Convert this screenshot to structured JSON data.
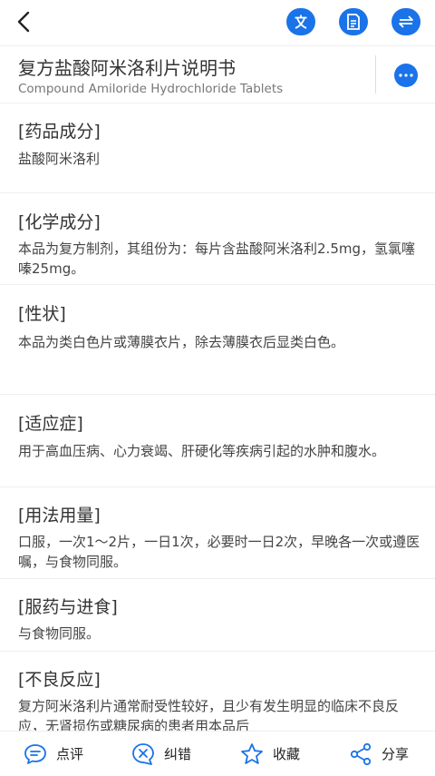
{
  "header": {
    "title_cn": "复方盐酸阿米洛利片说明书",
    "title_en": "Compound Amiloride Hydrochloride Tablets",
    "actions": [
      {
        "icon": "translate-icon"
      },
      {
        "icon": "document-icon"
      },
      {
        "icon": "swap-icon"
      }
    ],
    "accent_color": "#1a73e8"
  },
  "sections": [
    {
      "title": "[药品成分]",
      "body": "盐酸阿米洛利"
    },
    {
      "title": "[化学成分]",
      "body": "本品为复方制剂，其组份为：每片含盐酸阿米洛利2.5mg，氢氯噻嗪25mg。"
    },
    {
      "title": "[性状]",
      "body": "本品为类白色片或薄膜衣片，除去薄膜衣后显类白色。"
    },
    {
      "title": "[适应症]",
      "body": "用于高血压病、心力衰竭、肝硬化等疾病引起的水肿和腹水。"
    },
    {
      "title": "[用法用量]",
      "body": "口服，一次1～2片，一日1次，必要时一日2次，早晚各一次或遵医嘱，与食物同服。"
    },
    {
      "title": "[服药与进食]",
      "body": "与食物同服。"
    },
    {
      "title": "[不良反应]",
      "body": "复方阿米洛利片通常耐受性较好，且少有发生明显的临床不良反应，无肾损伤或糖尿病的患者用本品后"
    }
  ],
  "bottom_tabs": [
    {
      "label": "点评",
      "icon": "comment-icon"
    },
    {
      "label": "纠错",
      "icon": "error-correct-icon"
    },
    {
      "label": "收藏",
      "icon": "star-icon"
    },
    {
      "label": "分享",
      "icon": "share-icon"
    }
  ]
}
